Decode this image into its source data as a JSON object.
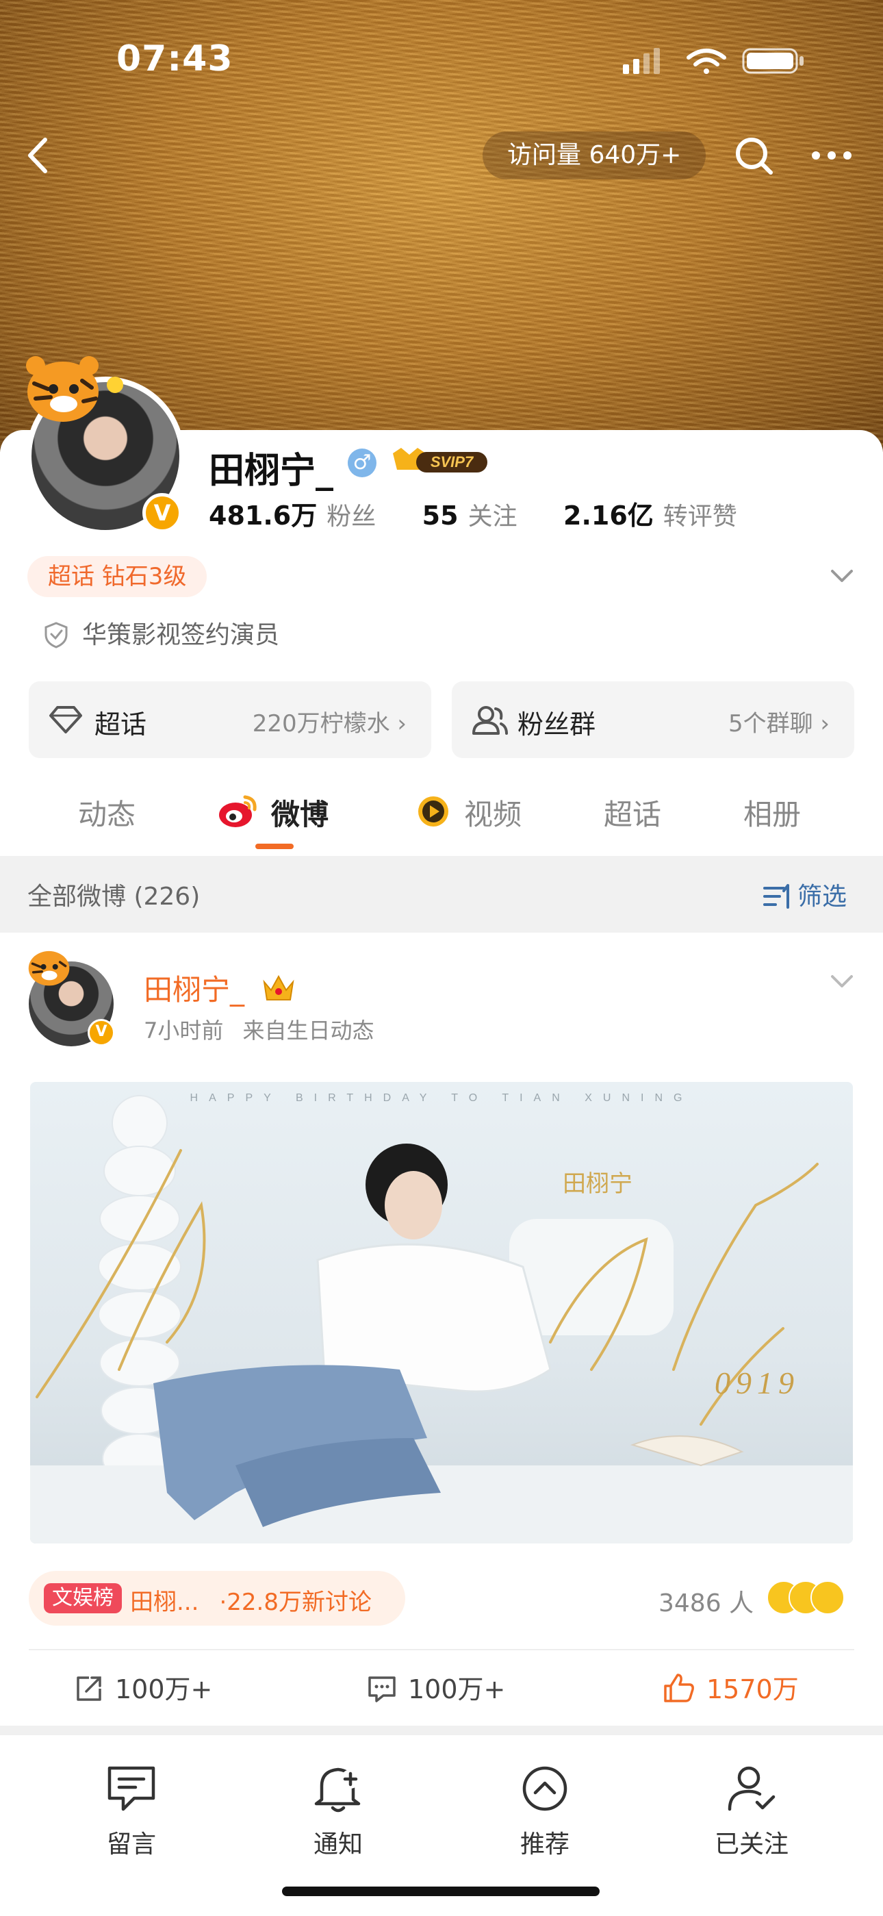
{
  "status_bar": {
    "time": "07:43"
  },
  "header": {
    "visit_count": "访问量 640万+"
  },
  "profile": {
    "name": "田栩宁_",
    "gender_symbol": "♂",
    "svip_label": "SVIP7",
    "stats": [
      {
        "value": "481.6万",
        "label": "粉丝"
      },
      {
        "value": "55",
        "label": "关注"
      },
      {
        "value": "2.16亿",
        "label": "转评赞"
      }
    ],
    "chaohua_level": "超话 钻石3级",
    "verification": "华策影视签约演员",
    "cards": [
      {
        "label": "超话",
        "value": "220万柠檬水 ›"
      },
      {
        "label": "粉丝群",
        "value": "5个群聊 ›"
      }
    ]
  },
  "tabs": [
    "动态",
    "微博",
    "视频",
    "超话",
    "相册"
  ],
  "active_tab": "微博",
  "filter": {
    "all_posts": "全部微博 (226)",
    "filter_label": "筛选"
  },
  "post": {
    "author": "田栩宁_",
    "time": "7小时前",
    "source": "来自生日动态",
    "image_banner_text": "HAPPY BIRTHDAY TO TIAN XUNING",
    "image_name": "田栩宁",
    "image_date": "0919",
    "hot_tag": "文娱榜",
    "hot_topic": "田栩...",
    "hot_count": "·22.8万新讨论",
    "people": "3486 人",
    "actions": {
      "repost": "100万+",
      "comment": "100万+",
      "like": "1570万"
    }
  },
  "bottom_bar": [
    "留言",
    "通知",
    "推荐",
    "已关注"
  ],
  "colors": {
    "accent": "#f26b25",
    "link": "#3b6ea8",
    "badge": "#f7a600"
  }
}
